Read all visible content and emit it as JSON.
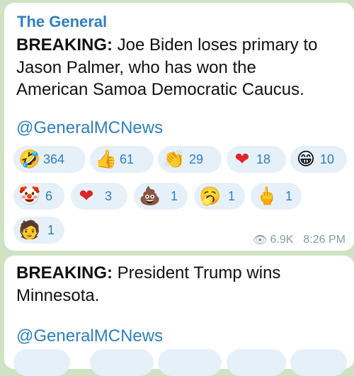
{
  "message1": {
    "channel": "The General",
    "breaking": "BREAKING:",
    "lines": [
      " Joe Biden loses primary to",
      "Jason Palmer, who has won the",
      "American Samoa Democratic Caucus."
    ],
    "handle": "@GeneralMCNews",
    "reactions": [
      {
        "icon": "rofl-emoji",
        "glyph": "🤣",
        "count": "364"
      },
      {
        "icon": "thumbs-up-emoji",
        "glyph": "👍",
        "count": "61"
      },
      {
        "icon": "clapping-emoji",
        "glyph": "👏",
        "count": "29"
      },
      {
        "icon": "heart-emoji",
        "glyph": "❤",
        "count": "18"
      },
      {
        "icon": "grin-emoji",
        "glyph": "😁",
        "count": "10"
      },
      {
        "icon": "clown-emoji",
        "glyph": "🤡",
        "count": "6"
      },
      {
        "icon": "heart-on-fire-emoji",
        "glyph": "❤",
        "count": "3"
      },
      {
        "icon": "poop-emoji",
        "glyph": "💩",
        "count": "1"
      },
      {
        "icon": "yawning-emoji",
        "glyph": "🥱",
        "count": "1"
      },
      {
        "icon": "middle-finger-emoji",
        "glyph": "🖕",
        "count": "1"
      },
      {
        "icon": "technologist-emoji",
        "glyph": "🧑",
        "count": "1"
      }
    ],
    "views": "6.9K",
    "time": "8:26 PM"
  },
  "message2": {
    "breaking": "BREAKING:",
    "lines": [
      " President Trump wins",
      "Minnesota."
    ],
    "handle": "@GeneralMCNews"
  },
  "colors": {
    "background": "#cfe3c4",
    "bubble": "#ffffff",
    "accent": "#2f7fc0",
    "pill": "#e6f0f9",
    "meta": "#8a9aa8"
  }
}
